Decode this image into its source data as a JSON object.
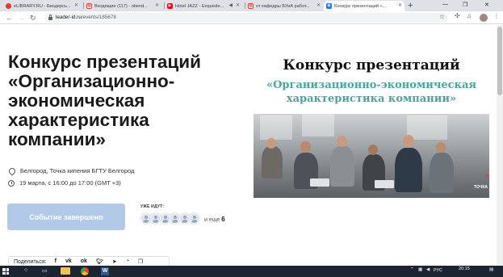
{
  "browser": {
    "tabs": [
      {
        "label": "eLIBRARY.RU - Биндерсь...",
        "favicon": "elibrary-icon",
        "color": "#e53935",
        "active": false
      },
      {
        "label": "Входящие (117) - obend...",
        "favicon": "gmail-icon",
        "color": "#ea4335",
        "active": false
      },
      {
        "label": "Hotel JAZZ - Exquisite...",
        "favicon": "youtube-icon",
        "color": "#ff0000",
        "active": false
      },
      {
        "label": "от кафедры БУиА работ...",
        "favicon": "gmail-icon",
        "color": "#ea4335",
        "active": false
      },
      {
        "label": "Конкурс презентаций «...",
        "favicon": "leader-id-icon",
        "color": "#1a73e8",
        "active": true
      }
    ],
    "new_tab": "+",
    "url_host": "leader-id.ru",
    "url_path": "/events/185678",
    "window_controls": {
      "minimize": "—",
      "maximize": "❐",
      "close": "✕"
    }
  },
  "event": {
    "title": "Конкурс презентаций «Организационно-экономическая характеристика компании»",
    "location": "Белгород, Точка кипения БГТУ Белгород",
    "datetime": "19 марта, с 16:00 до 17:00 (GMT +3)",
    "status_button": "Событие завершено",
    "going_label": "УЖЕ ИДУТ:",
    "going_more_prefix": "и еще",
    "going_more_count": "6",
    "share_label": "Поделиться:",
    "share_icons": [
      "f",
      "vk",
      "ok",
      "tw",
      "tg",
      "wa",
      "copy"
    ]
  },
  "banner": {
    "line1": "Конкурс презентаций",
    "line2": "«Организационно-экономическая характеристика компании»",
    "brand": "ТОЧКА"
  },
  "taskbar": {
    "lang": "РУС",
    "time": "20:15"
  },
  "colors": {
    "accent": "#b3c9e8",
    "banner_teal": "#4aa4a0",
    "taskbar": "#1b2430"
  }
}
